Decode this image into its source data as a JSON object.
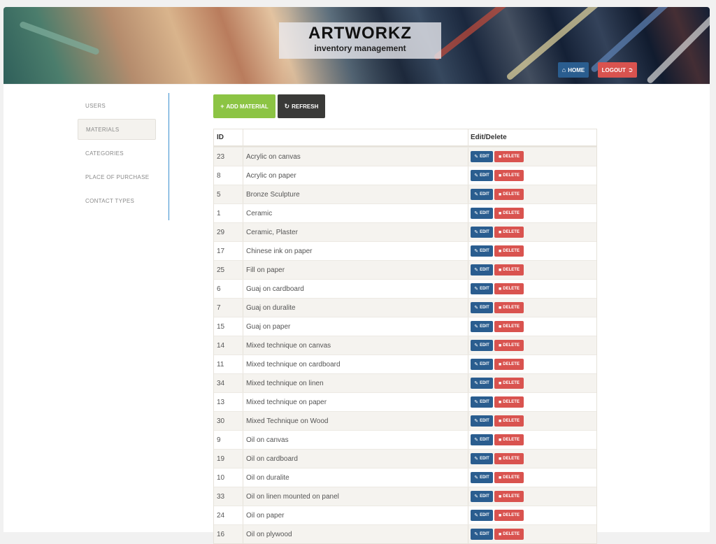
{
  "header": {
    "title": "ARTWORKZ",
    "subtitle": "inventory management",
    "home_label": "HOME",
    "logout_label": "LOGOUT"
  },
  "sidebar": {
    "items": [
      {
        "label": "USERS"
      },
      {
        "label": "MATERIALS",
        "active": true
      },
      {
        "label": "CATEGORIES"
      },
      {
        "label": "PLACE OF PURCHASE"
      },
      {
        "label": "CONTACT TYPES"
      }
    ]
  },
  "toolbar": {
    "add_label": "ADD MATERIAL",
    "refresh_label": "REFRESH"
  },
  "table": {
    "columns": [
      "ID",
      "",
      "Edit/Delete"
    ],
    "edit_label": "EDIT",
    "delete_label": "DELETE",
    "rows": [
      {
        "id": "23",
        "name": "Acrylic on canvas"
      },
      {
        "id": "8",
        "name": "Acrylic on paper"
      },
      {
        "id": "5",
        "name": "Bronze Sculpture"
      },
      {
        "id": "1",
        "name": "Ceramic"
      },
      {
        "id": "29",
        "name": "Ceramic, Plaster"
      },
      {
        "id": "17",
        "name": "Chinese ink on paper"
      },
      {
        "id": "25",
        "name": "Fill on paper"
      },
      {
        "id": "6",
        "name": "Guaj on cardboard"
      },
      {
        "id": "7",
        "name": "Guaj on duralite"
      },
      {
        "id": "15",
        "name": "Guaj on paper"
      },
      {
        "id": "14",
        "name": "Mixed technique on canvas"
      },
      {
        "id": "11",
        "name": "Mixed technique on cardboard"
      },
      {
        "id": "34",
        "name": "Mixed technique on linen"
      },
      {
        "id": "13",
        "name": "Mixed technique on paper"
      },
      {
        "id": "30",
        "name": "Mixed Technique on Wood"
      },
      {
        "id": "9",
        "name": "Oil on canvas"
      },
      {
        "id": "19",
        "name": "Oil on cardboard"
      },
      {
        "id": "10",
        "name": "Oil on duralite"
      },
      {
        "id": "33",
        "name": "Oil on linen mounted on panel"
      },
      {
        "id": "24",
        "name": "Oil on paper"
      },
      {
        "id": "16",
        "name": "Oil on plywood"
      }
    ]
  },
  "colors": {
    "primary": "#2a5d8f",
    "danger": "#d9534f",
    "success": "#8cc444",
    "dark": "#3a3a38"
  }
}
